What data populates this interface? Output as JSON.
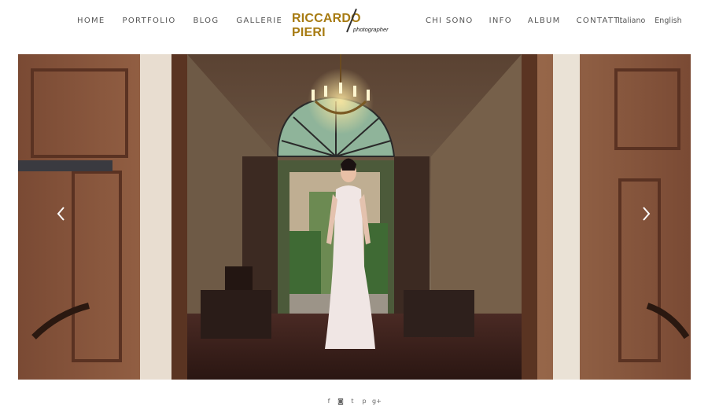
{
  "nav_left": [
    "HOME",
    "PORTFOLIO",
    "BLOG",
    "GALLERIE"
  ],
  "nav_right": [
    "CHI SONO",
    "INFO",
    "ALBUM",
    "CONTATTI"
  ],
  "languages": [
    "Italiano",
    "English"
  ],
  "logo": {
    "name": "RICCARDO PIERI",
    "tagline": "photographer"
  },
  "slider": {
    "prev_icon": "chevron-left-icon",
    "next_icon": "chevron-right-icon"
  },
  "social": [
    {
      "icon": "facebook-icon",
      "glyph": "f"
    },
    {
      "icon": "instagram-icon",
      "glyph": "◙"
    },
    {
      "icon": "twitter-icon",
      "glyph": "t"
    },
    {
      "icon": "pinterest-icon",
      "glyph": "p"
    },
    {
      "icon": "google-plus-icon",
      "glyph": "g+"
    }
  ],
  "colors": {
    "brand": "#a77b12",
    "nav_text": "#555555"
  }
}
